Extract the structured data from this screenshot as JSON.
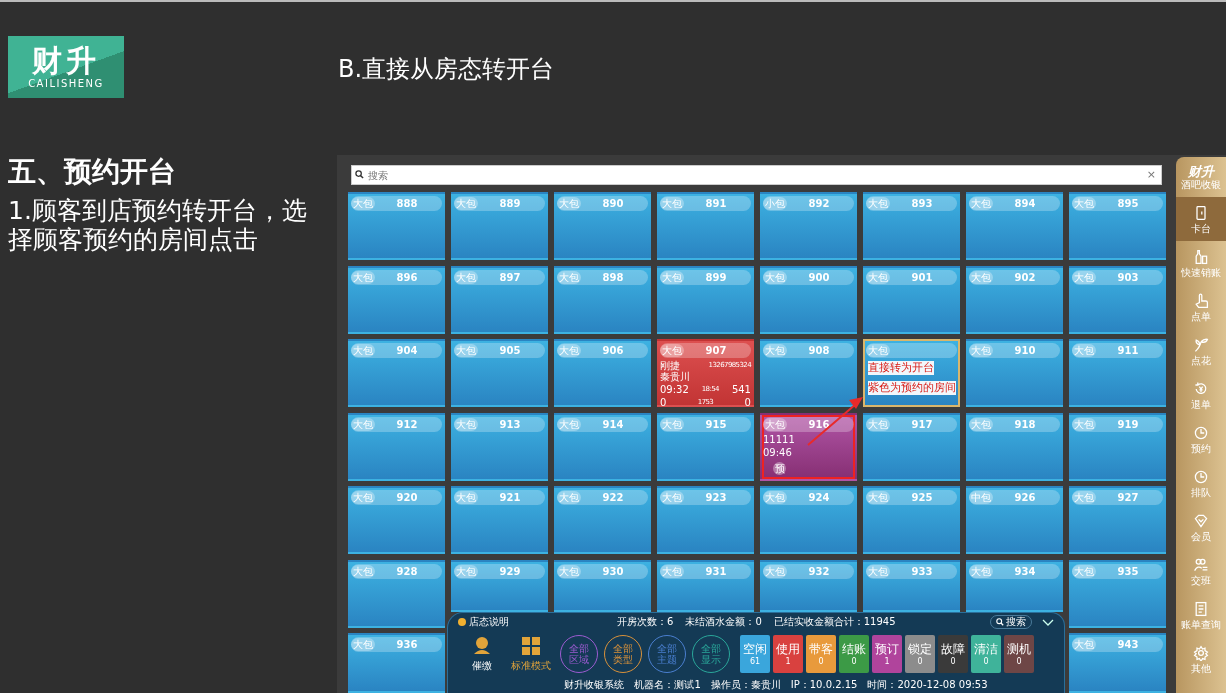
{
  "logo": {
    "text": "财升",
    "subtitle": "CAILISHENG"
  },
  "slide_title": "B.直接从房态转开台",
  "section_heading": "五、预约开台",
  "step_text": "1.顾客到店预约转开台，选择顾客预约的房间点击",
  "search": {
    "placeholder": "搜索",
    "clear": "×"
  },
  "grid": {
    "rows": [
      [
        {
          "type": "大包",
          "number": "888",
          "kind": "free",
          "selected": false,
          "highlighted": false
        },
        {
          "type": "大包",
          "number": "889",
          "kind": "free",
          "selected": false,
          "highlighted": false
        },
        {
          "type": "大包",
          "number": "890",
          "kind": "free",
          "selected": false,
          "highlighted": false
        },
        {
          "type": "大包",
          "number": "891",
          "kind": "free",
          "selected": false,
          "highlighted": false
        },
        {
          "type": "小包",
          "number": "892",
          "kind": "free",
          "selected": false,
          "highlighted": false
        },
        {
          "type": "大包",
          "number": "893",
          "kind": "free",
          "selected": false,
          "highlighted": false
        },
        {
          "type": "大包",
          "number": "894",
          "kind": "free",
          "selected": false,
          "highlighted": false
        },
        {
          "type": "大包",
          "number": "895",
          "kind": "free",
          "selected": false,
          "highlighted": false
        }
      ],
      [
        {
          "type": "大包",
          "number": "896",
          "kind": "free",
          "selected": false,
          "highlighted": false
        },
        {
          "type": "大包",
          "number": "897",
          "kind": "free",
          "selected": false,
          "highlighted": false
        },
        {
          "type": "大包",
          "number": "898",
          "kind": "free",
          "selected": false,
          "highlighted": false
        },
        {
          "type": "大包",
          "number": "899",
          "kind": "free",
          "selected": false,
          "highlighted": false
        },
        {
          "type": "大包",
          "number": "900",
          "kind": "free",
          "selected": false,
          "highlighted": false
        },
        {
          "type": "大包",
          "number": "901",
          "kind": "free",
          "selected": false,
          "highlighted": false
        },
        {
          "type": "大包",
          "number": "902",
          "kind": "free",
          "selected": false,
          "highlighted": false
        },
        {
          "type": "大包",
          "number": "903",
          "kind": "free",
          "selected": false,
          "highlighted": false
        }
      ],
      [
        {
          "type": "大包",
          "number": "904",
          "kind": "free",
          "selected": false,
          "highlighted": false
        },
        {
          "type": "大包",
          "number": "905",
          "kind": "free",
          "selected": false,
          "highlighted": false
        },
        {
          "type": "大包",
          "number": "906",
          "kind": "free",
          "selected": false,
          "highlighted": false
        },
        {
          "type": "大包",
          "number": "907",
          "kind": "in_use",
          "selected": false,
          "highlighted": false,
          "details": [
            [
              "刚捷",
              "13267985324",
              "秦贵川"
            ],
            [
              "09:32",
              "18:54",
              "541"
            ],
            [
              "0",
              "1753",
              "0"
            ]
          ]
        },
        {
          "type": "大包",
          "number": "908",
          "kind": "free",
          "selected": false,
          "highlighted": false
        },
        {
          "type": "大包",
          "kind": "free",
          "selected": true,
          "highlighted": false
        },
        {
          "type": "大包",
          "number": "910",
          "kind": "free",
          "selected": false,
          "highlighted": false
        },
        {
          "type": "大包",
          "number": "911",
          "kind": "free",
          "selected": false,
          "highlighted": false
        }
      ],
      [
        {
          "type": "大包",
          "number": "912",
          "kind": "free",
          "selected": false,
          "highlighted": false
        },
        {
          "type": "大包",
          "number": "913",
          "kind": "free",
          "selected": false,
          "highlighted": false
        },
        {
          "type": "大包",
          "number": "914",
          "kind": "free",
          "selected": false,
          "highlighted": false
        },
        {
          "type": "大包",
          "number": "915",
          "kind": "free",
          "selected": false,
          "highlighted": false
        },
        {
          "type": "大包",
          "number": "916",
          "kind": "reserved",
          "selected": false,
          "highlighted": true,
          "details": [
            [
              "11111"
            ],
            [
              "09:46"
            ]
          ],
          "mark": "预"
        },
        {
          "type": "大包",
          "number": "917",
          "kind": "free",
          "selected": false,
          "highlighted": false
        },
        {
          "type": "大包",
          "number": "918",
          "kind": "free",
          "selected": false,
          "highlighted": false
        },
        {
          "type": "大包",
          "number": "919",
          "kind": "free",
          "selected": false,
          "highlighted": false
        }
      ],
      [
        {
          "type": "大包",
          "number": "920",
          "kind": "free",
          "selected": false,
          "highlighted": false
        },
        {
          "type": "大包",
          "number": "921",
          "kind": "free",
          "selected": false,
          "highlighted": false
        },
        {
          "type": "大包",
          "number": "922",
          "kind": "free",
          "selected": false,
          "highlighted": false
        },
        {
          "type": "大包",
          "number": "923",
          "kind": "free",
          "selected": false,
          "highlighted": false
        },
        {
          "type": "大包",
          "number": "924",
          "kind": "free",
          "selected": false,
          "highlighted": false
        },
        {
          "type": "大包",
          "number": "925",
          "kind": "free",
          "selected": false,
          "highlighted": false
        },
        {
          "type": "中包",
          "number": "926",
          "kind": "free",
          "selected": false,
          "highlighted": false
        },
        {
          "type": "大包",
          "number": "927",
          "kind": "free",
          "selected": false,
          "highlighted": false
        }
      ],
      [
        {
          "type": "大包",
          "number": "928",
          "kind": "free",
          "selected": false,
          "highlighted": false
        },
        {
          "type": "大包",
          "number": "929",
          "kind": "free",
          "selected": false,
          "highlighted": false
        },
        {
          "type": "大包",
          "number": "930",
          "kind": "free",
          "selected": false,
          "highlighted": false
        },
        {
          "type": "大包",
          "number": "931",
          "kind": "free",
          "selected": false,
          "highlighted": false
        },
        {
          "type": "大包",
          "number": "932",
          "kind": "free",
          "selected": false,
          "highlighted": false
        },
        {
          "type": "大包",
          "number": "933",
          "kind": "free",
          "selected": false,
          "highlighted": false
        },
        {
          "type": "大包",
          "number": "934",
          "kind": "free",
          "selected": false,
          "highlighted": false
        },
        {
          "type": "大包",
          "number": "935",
          "kind": "free",
          "selected": false,
          "highlighted": false
        }
      ],
      [
        {
          "type": "大包",
          "number": "936",
          "kind": "free",
          "selected": false,
          "highlighted": false
        },
        null,
        null,
        null,
        null,
        null,
        null,
        {
          "type": "大包",
          "number": "943",
          "kind": "free",
          "selected": false,
          "highlighted": false
        }
      ]
    ]
  },
  "annotation": {
    "lines": [
      "直接转为开台",
      "紫色为预约的房间"
    ]
  },
  "sidebar": {
    "brand": "财升",
    "subtitle": "酒吧收银",
    "items": [
      {
        "label": "卡台",
        "selected": true
      },
      {
        "label": "快速销账",
        "selected": false
      },
      {
        "label": "点单",
        "selected": false
      },
      {
        "label": "点花",
        "selected": false
      },
      {
        "label": "退单",
        "selected": false
      },
      {
        "label": "预约",
        "selected": false
      },
      {
        "label": "排队",
        "selected": false
      },
      {
        "label": "会员",
        "selected": false
      },
      {
        "label": "交班",
        "selected": false
      },
      {
        "label": "账单查询",
        "selected": false
      },
      {
        "label": "其他",
        "selected": false
      }
    ]
  },
  "bottom_bar": {
    "legend_link": "店态说明",
    "stats": [
      "开房次数：6",
      "未结酒水金额：0",
      "已结实收金额合计：11945"
    ],
    "search_button": "搜索",
    "actions": [
      "催缴",
      "标准模式"
    ],
    "filters": [
      {
        "label": "全部区域",
        "color": "#9b5bd0"
      },
      {
        "label": "全部类型",
        "color": "#d8913a"
      },
      {
        "label": "全部主题",
        "color": "#4a7fd0"
      },
      {
        "label": "全部显示",
        "color": "#2aa79a"
      }
    ],
    "statuses": [
      {
        "label": "空闲",
        "count": "61",
        "color": "#3aa6dc"
      },
      {
        "label": "使用",
        "count": "1",
        "color": "#d9413f"
      },
      {
        "label": "带客",
        "count": "0",
        "color": "#e89a3c"
      },
      {
        "label": "结账",
        "count": "0",
        "color": "#3c9a46"
      },
      {
        "label": "预订",
        "count": "1",
        "color": "#b0449c"
      },
      {
        "label": "锁定",
        "count": "0",
        "color": "#8c8c8c"
      },
      {
        "label": "故障",
        "count": "0",
        "color": "#3a3a3a"
      },
      {
        "label": "清洁",
        "count": "0",
        "color": "#3fb39a"
      },
      {
        "label": "测机",
        "count": "0",
        "color": "#6e4646"
      }
    ],
    "footer": [
      "财升收银系统",
      "机器名：测试1",
      "操作员：秦贵川",
      "IP：10.0.2.15",
      "时间：2020-12-08 09:53"
    ]
  }
}
